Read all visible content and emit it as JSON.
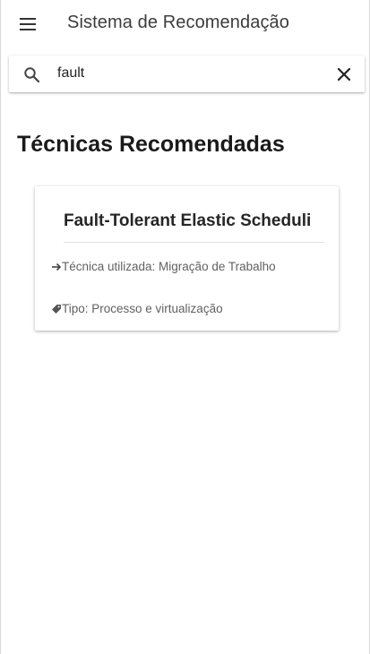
{
  "appbar": {
    "title": "Sistema de Recomendação",
    "menu_icon": "menu-icon"
  },
  "search": {
    "value": "fault",
    "search_icon": "search-icon",
    "clear_icon": "close-icon"
  },
  "section": {
    "title": "Técnicas Recomendadas"
  },
  "results": [
    {
      "title": "Fault-Tolerant Elastic Scheduling",
      "technique_text": "Técnica utilizada: Migração de Trabalho",
      "type_text": "Tipo: Processo e virtualização",
      "technique_icon": "arrow-right-icon",
      "type_icon": "tag-icon"
    }
  ],
  "colors": {
    "title_text": "#3c3c3c",
    "secondary_text": "#616161",
    "heading_text": "#1a1a1a"
  }
}
